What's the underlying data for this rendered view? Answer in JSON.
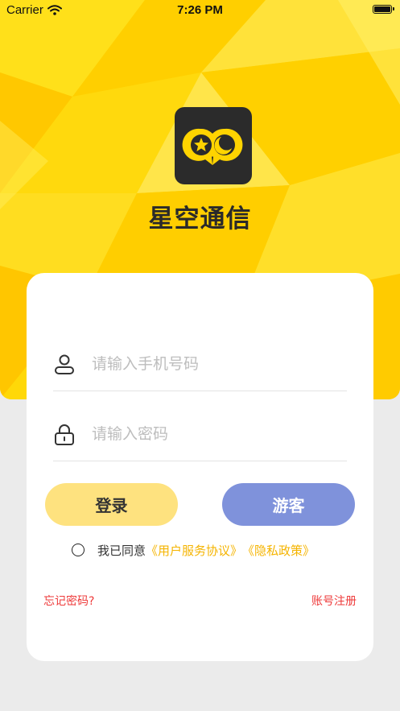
{
  "status_bar": {
    "carrier": "Carrier",
    "time": "7:26 PM"
  },
  "app": {
    "name": "星空通信",
    "logo_icon": "chat-bubbles-star-moon-icon"
  },
  "login": {
    "phone_placeholder": "请输入手机号码",
    "phone_value": "",
    "password_placeholder": "请输入密码",
    "password_value": "",
    "login_button": "登录",
    "guest_button": "游客",
    "agreement_prefix": "我已同意",
    "user_agreement": "《用户服务协议》",
    "privacy_policy": "《隐私政策》",
    "forgot_password": "忘记密码?",
    "register": "账号注册"
  },
  "icons": {
    "phone_field": "user-icon",
    "password_field": "lock-icon",
    "agreement": "radio-unchecked-icon",
    "signal": "wifi-icon",
    "battery": "battery-icon"
  },
  "colors": {
    "hero_yellow": "#ffd400",
    "login_button": "#fee27f",
    "guest_button": "#7f92db",
    "link_gold": "#f5b400",
    "link_red": "#ee3a3a",
    "page_background": "#ebebeb"
  }
}
